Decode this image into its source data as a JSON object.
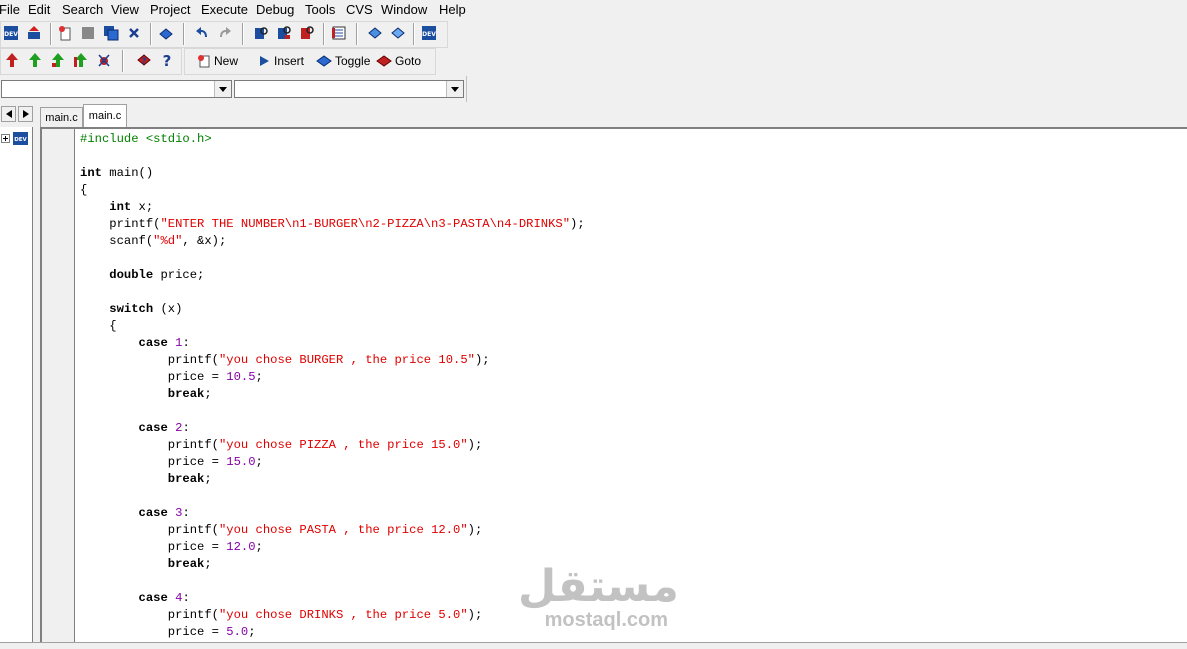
{
  "menu": [
    "File",
    "Edit",
    "Search",
    "View",
    "Project",
    "Execute",
    "Debug",
    "Tools",
    "CVS",
    "Window",
    "Help"
  ],
  "toolbar_buttons": {
    "new": "New",
    "insert": "Insert",
    "toggle": "Toggle",
    "goto": "Goto"
  },
  "tabs": [
    "main.c",
    "main.c"
  ],
  "colors": {
    "string": "#e00000",
    "number": "#8800aa",
    "preprocessor": "#008000",
    "keyword": "#000000"
  },
  "code_lines": [
    [
      {
        "t": "#include <stdio.h>",
        "c": "pre"
      }
    ],
    [],
    [
      {
        "t": "int",
        "c": "kw"
      },
      {
        "t": " main()",
        "c": ""
      }
    ],
    [
      {
        "t": "{",
        "c": ""
      }
    ],
    [
      {
        "t": "    ",
        "c": ""
      },
      {
        "t": "int",
        "c": "kw"
      },
      {
        "t": " x;",
        "c": ""
      }
    ],
    [
      {
        "t": "    printf(",
        "c": ""
      },
      {
        "t": "\"ENTER THE NUMBER\\n1-BURGER\\n2-PIZZA\\n3-PASTA\\n4-DRINKS\"",
        "c": "str"
      },
      {
        "t": ");",
        "c": ""
      }
    ],
    [
      {
        "t": "    scanf(",
        "c": ""
      },
      {
        "t": "\"%d\"",
        "c": "str"
      },
      {
        "t": ", &x);",
        "c": ""
      }
    ],
    [],
    [
      {
        "t": "    ",
        "c": ""
      },
      {
        "t": "double",
        "c": "kw"
      },
      {
        "t": " price;",
        "c": ""
      }
    ],
    [],
    [
      {
        "t": "    ",
        "c": ""
      },
      {
        "t": "switch",
        "c": "kw"
      },
      {
        "t": " (x)",
        "c": ""
      }
    ],
    [
      {
        "t": "    {",
        "c": ""
      }
    ],
    [
      {
        "t": "        ",
        "c": ""
      },
      {
        "t": "case",
        "c": "kw"
      },
      {
        "t": " ",
        "c": ""
      },
      {
        "t": "1",
        "c": "num"
      },
      {
        "t": ":",
        "c": ""
      }
    ],
    [
      {
        "t": "            printf(",
        "c": ""
      },
      {
        "t": "\"you chose BURGER , the price 10.5\"",
        "c": "str"
      },
      {
        "t": ");",
        "c": ""
      }
    ],
    [
      {
        "t": "            price = ",
        "c": ""
      },
      {
        "t": "10.5",
        "c": "num"
      },
      {
        "t": ";",
        "c": ""
      }
    ],
    [
      {
        "t": "            ",
        "c": ""
      },
      {
        "t": "break",
        "c": "kw"
      },
      {
        "t": ";",
        "c": ""
      }
    ],
    [],
    [
      {
        "t": "        ",
        "c": ""
      },
      {
        "t": "case",
        "c": "kw"
      },
      {
        "t": " ",
        "c": ""
      },
      {
        "t": "2",
        "c": "num"
      },
      {
        "t": ":",
        "c": ""
      }
    ],
    [
      {
        "t": "            printf(",
        "c": ""
      },
      {
        "t": "\"you chose PIZZA , the price 15.0\"",
        "c": "str"
      },
      {
        "t": ");",
        "c": ""
      }
    ],
    [
      {
        "t": "            price = ",
        "c": ""
      },
      {
        "t": "15.0",
        "c": "num"
      },
      {
        "t": ";",
        "c": ""
      }
    ],
    [
      {
        "t": "            ",
        "c": ""
      },
      {
        "t": "break",
        "c": "kw"
      },
      {
        "t": ";",
        "c": ""
      }
    ],
    [],
    [
      {
        "t": "        ",
        "c": ""
      },
      {
        "t": "case",
        "c": "kw"
      },
      {
        "t": " ",
        "c": ""
      },
      {
        "t": "3",
        "c": "num"
      },
      {
        "t": ":",
        "c": ""
      }
    ],
    [
      {
        "t": "            printf(",
        "c": ""
      },
      {
        "t": "\"you chose PASTA , the price 12.0\"",
        "c": "str"
      },
      {
        "t": ");",
        "c": ""
      }
    ],
    [
      {
        "t": "            price = ",
        "c": ""
      },
      {
        "t": "12.0",
        "c": "num"
      },
      {
        "t": ";",
        "c": ""
      }
    ],
    [
      {
        "t": "            ",
        "c": ""
      },
      {
        "t": "break",
        "c": "kw"
      },
      {
        "t": ";",
        "c": ""
      }
    ],
    [],
    [
      {
        "t": "        ",
        "c": ""
      },
      {
        "t": "case",
        "c": "kw"
      },
      {
        "t": " ",
        "c": ""
      },
      {
        "t": "4",
        "c": "num"
      },
      {
        "t": ":",
        "c": ""
      }
    ],
    [
      {
        "t": "            printf(",
        "c": ""
      },
      {
        "t": "\"you chose DRINKS , the price 5.0\"",
        "c": "str"
      },
      {
        "t": ");",
        "c": ""
      }
    ],
    [
      {
        "t": "            price = ",
        "c": ""
      },
      {
        "t": "5.0",
        "c": "num"
      },
      {
        "t": ";",
        "c": ""
      }
    ]
  ],
  "watermark": {
    "arabic": "مستقل",
    "latin": "mostaql.com"
  }
}
